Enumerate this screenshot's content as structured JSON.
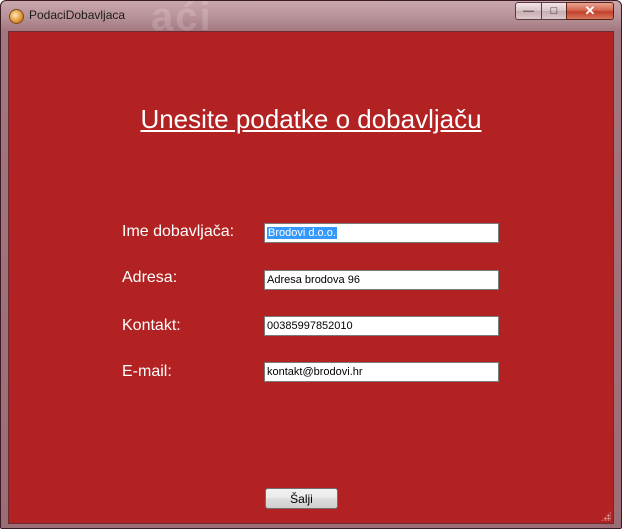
{
  "window": {
    "title": "PodaciDobavljaca",
    "ghost_title": "aći",
    "controls": {
      "minimize": "—",
      "maximize": "□",
      "close": "✕"
    }
  },
  "form": {
    "heading": "Unesite podatke o dobavljaču",
    "fields": [
      {
        "label": "Ime dobavljača:",
        "value": "Brodovi d.o.o.",
        "selected": true
      },
      {
        "label": "Adresa:",
        "value": "Adresa brodova 96"
      },
      {
        "label": "Kontakt:",
        "value": "00385997852010"
      },
      {
        "label": "E-mail:",
        "value": "kontakt@brodovi.hr"
      }
    ],
    "submit_label": "Šalji"
  },
  "colors": {
    "background": "#b22222",
    "text": "#ffffff",
    "selection": "#3399ff"
  }
}
